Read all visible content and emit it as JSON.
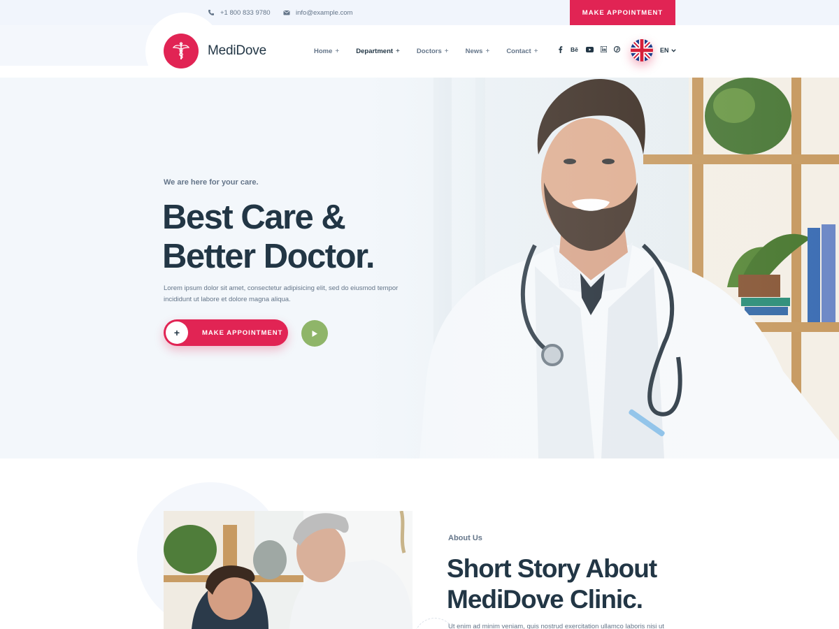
{
  "topbar": {
    "phone": "+1 800 833 9780",
    "email": "info@example.com",
    "cta_label": "MAKE APPOINTMENT"
  },
  "brand": {
    "name": "MediDove",
    "accent": "#e12454",
    "dark": "#223645",
    "muted": "#647589",
    "green": "#8fb569"
  },
  "nav": {
    "items": [
      {
        "label": "Home",
        "suffix": "+"
      },
      {
        "label": "Department",
        "suffix": "+"
      },
      {
        "label": "Doctors",
        "suffix": "+"
      },
      {
        "label": "News",
        "suffix": "+"
      },
      {
        "label": "Contact",
        "suffix": "+"
      }
    ],
    "socials": [
      "facebook-icon",
      "behance-icon",
      "youtube-icon",
      "linkedin-icon",
      "pinterest-icon"
    ],
    "language": "EN"
  },
  "hero": {
    "tagline": "We are here for your care.",
    "title_line1": "Best Care &",
    "title_line2": "Better Doctor.",
    "description": "Lorem ipsum dolor sit amet, consectetur adipisicing elit, sed do eiusmod tempor incididunt ut labore et dolore magna aliqua.",
    "button_label": "MAKE APPOINTMENT"
  },
  "about": {
    "label": "About Us",
    "title_line1": "Short Story About",
    "title_line2": "MediDove Clinic.",
    "text": "Ut enim ad minim veniam, quis nostrud exercitation ullamco laboris nisi ut"
  }
}
